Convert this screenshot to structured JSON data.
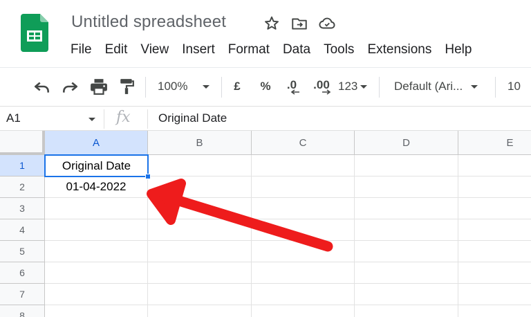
{
  "app": {
    "title": "Untitled spreadsheet",
    "menu": [
      "File",
      "Edit",
      "View",
      "Insert",
      "Format",
      "Data",
      "Tools",
      "Extensions",
      "Help"
    ]
  },
  "toolbar": {
    "zoom": "100%",
    "currency": "£",
    "percent": "%",
    "decrease_decimal": ".0",
    "increase_decimal": ".00",
    "more_formats": "123",
    "font": "Default (Ari...",
    "font_size": "10"
  },
  "formula_bar": {
    "cell_ref": "A1",
    "fx": "fx",
    "content": "Original Date"
  },
  "grid": {
    "columns": [
      "A",
      "B",
      "C",
      "D",
      "E"
    ],
    "rows": [
      "1",
      "2",
      "3",
      "4",
      "5",
      "6",
      "7",
      "8"
    ],
    "cells": {
      "A1": "Original Date",
      "A2": "01-04-2022"
    },
    "active_cell": "A1"
  },
  "colors": {
    "accent": "#1a73e8",
    "logo_green": "#0f9d58",
    "arrow_red": "#ee1c1c",
    "selected_header": "#d3e3fd"
  },
  "icons": [
    "sheets-logo-icon",
    "star-icon",
    "move-to-folder-icon",
    "cloud-status-icon",
    "undo-icon",
    "redo-icon",
    "print-icon",
    "paint-format-icon"
  ]
}
